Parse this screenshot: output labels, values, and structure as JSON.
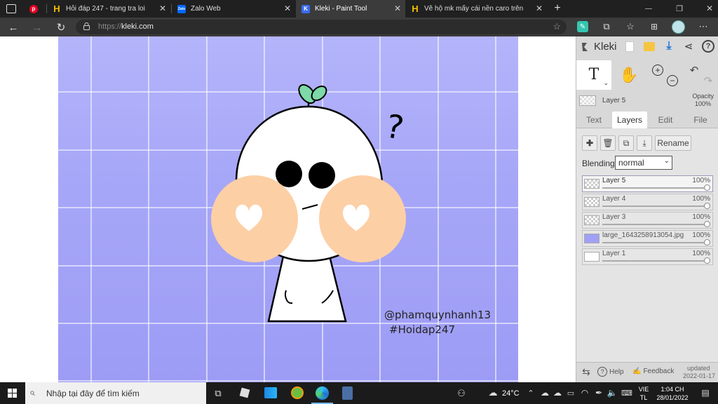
{
  "browser": {
    "tabs": [
      {
        "title": "",
        "icon": "pinterest-icon",
        "color": "#e60023"
      },
      {
        "title": "Hỏi đáp 247 - trang tra loi",
        "icon": "hoidap-icon",
        "color": "#f5c000"
      },
      {
        "title": "Zalo Web",
        "icon": "zalo-icon",
        "color": "#0068ff"
      },
      {
        "title": "Kleki - Paint Tool",
        "icon": "kleki-icon",
        "color": "#3a6cf0"
      },
      {
        "title": "Vẽ hộ mk mấy cái nền caro trên",
        "icon": "hoidap-icon",
        "color": "#f5c000"
      }
    ],
    "url_scheme": "https://",
    "url_host": "kleki.com"
  },
  "canvas": {
    "watermark_line1": "@phamquynhanh13",
    "watermark_line2": "#Hoidap247",
    "question_mark": "?",
    "bg_color": "#a6a6f8",
    "cheek_color": "#fdcfa5",
    "sprout_color": "#7dd9a7"
  },
  "kleki": {
    "logo": "Kleki",
    "tool_text_glyph": "T",
    "current_layer": "Layer 5",
    "opacity_label": "Opacity",
    "opacity_value": "100%",
    "tabs": [
      "Text",
      "Layers",
      "Edit",
      "File"
    ],
    "active_tab": "Layers",
    "rename_label": "Rename",
    "blending_label": "Blending",
    "blending_value": "normal",
    "layers": [
      {
        "name": "Layer 5",
        "opacity": "100%"
      },
      {
        "name": "Layer 4",
        "opacity": "100%"
      },
      {
        "name": "Layer 3",
        "opacity": "100%"
      },
      {
        "name": "large_1643258913054.jpg",
        "opacity": "100%"
      },
      {
        "name": "Layer 1",
        "opacity": "100%"
      }
    ],
    "help_label": "Help",
    "feedback_label": "Feedback",
    "updated_label": "updated",
    "updated_date": "2022-01-17"
  },
  "taskbar": {
    "search_placeholder": "Nhập tại đây để tìm kiếm",
    "weather": "24°C",
    "lang_line1": "VIE",
    "lang_line2": "TL",
    "time": "1:04 CH",
    "date": "28/01/2022"
  }
}
